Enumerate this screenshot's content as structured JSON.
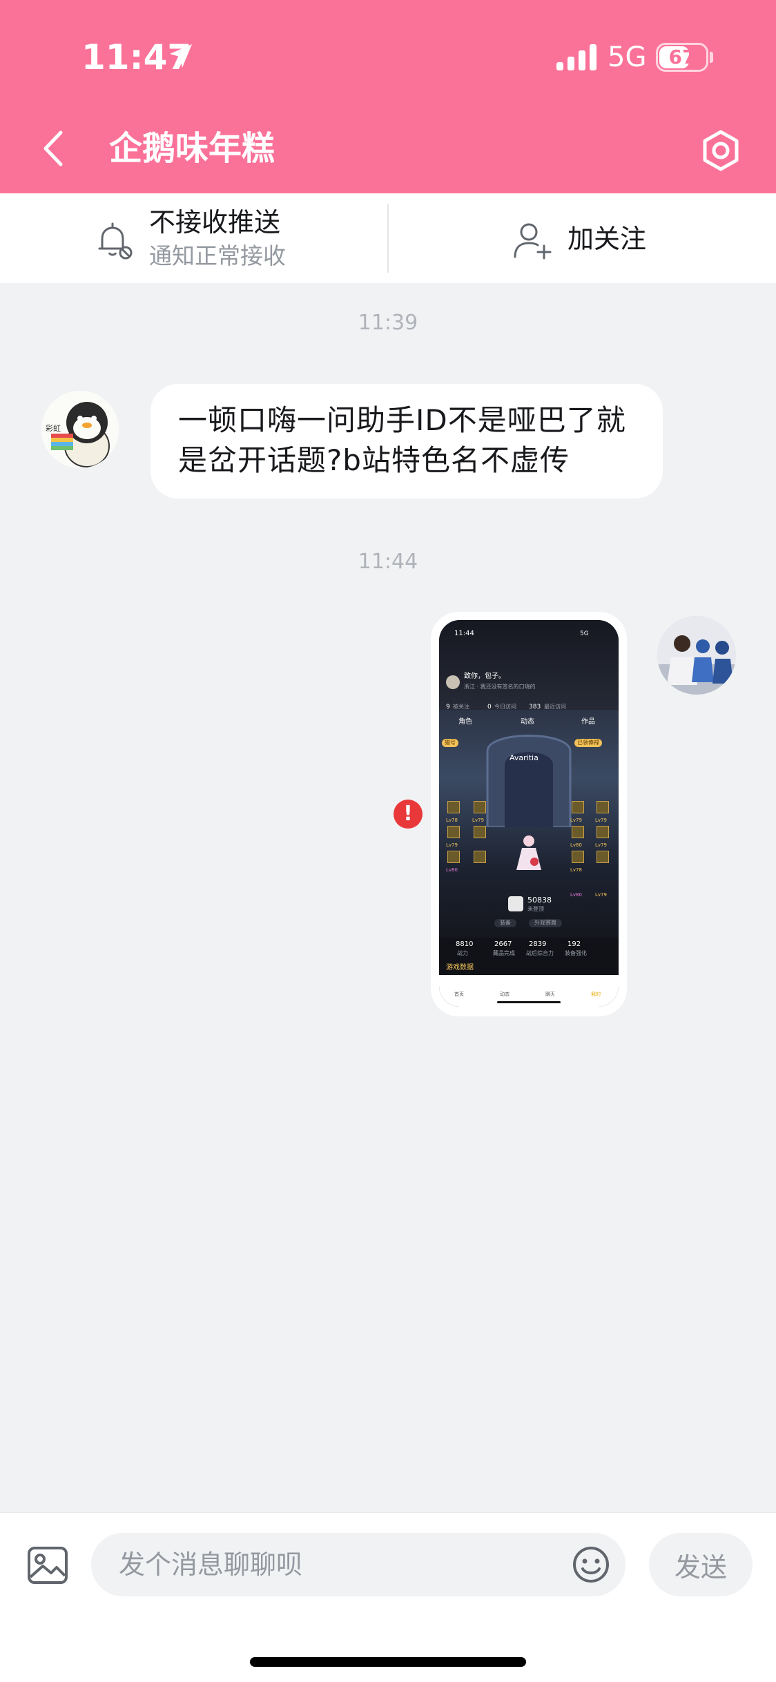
{
  "status_bar": {
    "time": "11:47",
    "network": "5G",
    "battery": "67"
  },
  "header": {
    "title": "企鹅味年糕"
  },
  "action_bar": {
    "push_label": "不接收推送",
    "push_sub": "通知正常接收",
    "follow_label": "加关注"
  },
  "messages": [
    {
      "timestamp": "11:39",
      "from": "other",
      "text": "一顿口嗨一问助手ID不是哑巴了就是岔开话题?b站特色名不虚传",
      "avatar_text": "彩虹"
    },
    {
      "timestamp": "11:44",
      "from": "me",
      "type": "image",
      "status": "failed",
      "error_mark": "!"
    }
  ],
  "screenshot": {
    "time": "11:44",
    "network": "5G",
    "name": "致你，包子。",
    "bio": "浙江 · 我还没有签名的口嗨的",
    "stats_top": [
      {
        "value": "9",
        "label": "被关注"
      },
      {
        "value": "0",
        "label": "今日访问"
      },
      {
        "value": "383",
        "label": "最近访问"
      }
    ],
    "tabs": [
      "角色",
      "动态",
      "作品"
    ],
    "left_badge": "猎号",
    "right_badge": "已领俸禄",
    "char_name": "Avaritia",
    "score": "50838",
    "score_label": "未登顶",
    "buttons": [
      "装备",
      "外观赛舞"
    ],
    "stats_bottom": [
      {
        "value": "8810",
        "label": "战力"
      },
      {
        "value": "2667",
        "label": "藏品完成"
      },
      {
        "value": "2839",
        "label": "战后综合力"
      },
      {
        "value": "192",
        "label": "装备强化"
      }
    ],
    "section_label": "游戏数据",
    "nav": [
      "首页",
      "动态",
      "聊天",
      "我的"
    ],
    "level_tags": [
      "Lv78",
      "Lv79",
      "Lv79",
      "Lv80",
      "Lv79",
      "Lv79",
      "Lv80",
      "Lv79",
      "Lv78",
      "Lv80",
      "Lv79"
    ]
  },
  "input_bar": {
    "placeholder": "发个消息聊聊呗",
    "send_label": "发送"
  },
  "colors": {
    "brand": "#fb7299",
    "error": "#e9383a",
    "background": "#f1f2f4"
  }
}
